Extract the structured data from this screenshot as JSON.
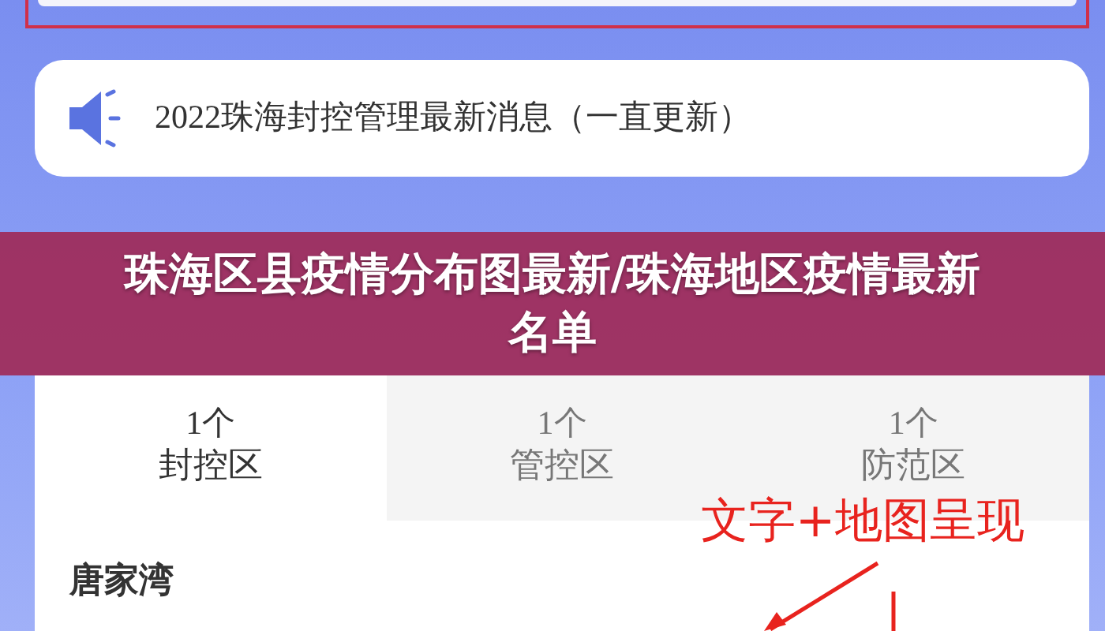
{
  "notice": {
    "text": "2022珠海封控管理最新消息（一直更新）"
  },
  "banner": {
    "title": "珠海区县疫情分布图最新/珠海地区疫情最新名单"
  },
  "tabs": [
    {
      "count": "1个",
      "label": "封控区",
      "selected": true
    },
    {
      "count": "1个",
      "label": "管控区",
      "selected": false
    },
    {
      "count": "1个",
      "label": "防范区",
      "selected": false
    }
  ],
  "area": {
    "name": "唐家湾"
  },
  "annotation": {
    "text": "文字+地图呈现"
  }
}
